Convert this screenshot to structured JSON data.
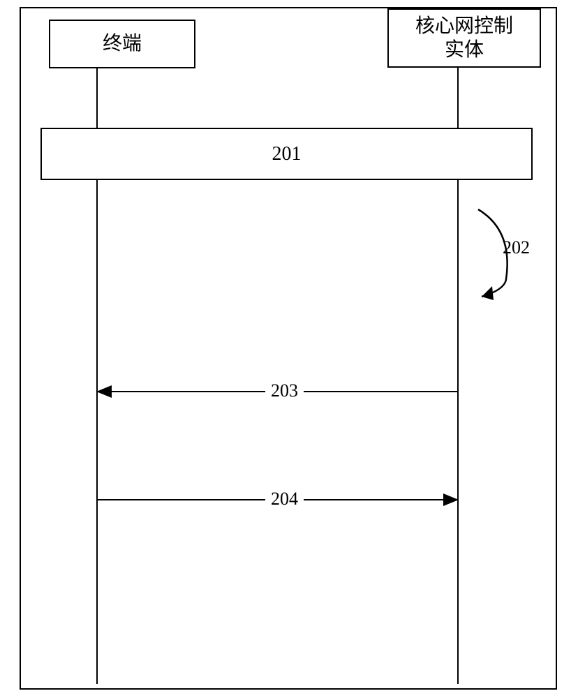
{
  "participants": {
    "terminal": "终端",
    "core_network": "核心网控制\n实体"
  },
  "activation": {
    "label": "201"
  },
  "self_message": {
    "label": "202"
  },
  "messages": {
    "msg1": "203",
    "msg2": "204"
  }
}
